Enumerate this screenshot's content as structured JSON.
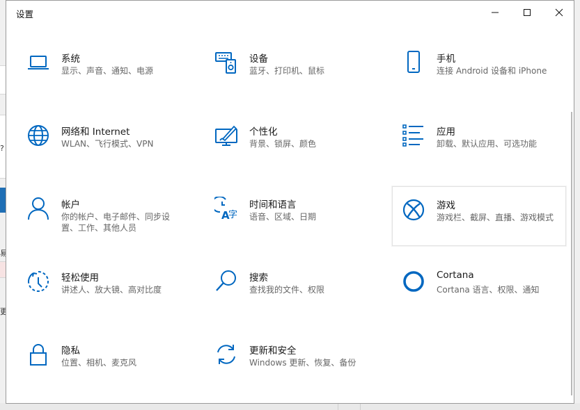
{
  "window": {
    "title": "设置"
  },
  "controls": {
    "minimize": "minimize-icon",
    "maximize": "maximize-icon",
    "close": "close-icon"
  },
  "accent": "#0067c0",
  "background_fragments": {
    "question": "?",
    "char_yi": "易",
    "char_geng": "更"
  },
  "tiles": [
    {
      "key": "system",
      "title": "系统",
      "desc": "显示、声音、通知、电源",
      "icon": "laptop-icon"
    },
    {
      "key": "devices",
      "title": "设备",
      "desc": "蓝牙、打印机、鼠标",
      "icon": "devices-icon"
    },
    {
      "key": "phone",
      "title": "手机",
      "desc": "连接 Android 设备和 iPhone",
      "icon": "phone-icon"
    },
    {
      "key": "network",
      "title": "网络和 Internet",
      "desc": "WLAN、飞行模式、VPN",
      "icon": "globe-icon"
    },
    {
      "key": "personalization",
      "title": "个性化",
      "desc": "背景、锁屏、颜色",
      "icon": "personalization-icon"
    },
    {
      "key": "apps",
      "title": "应用",
      "desc": "卸载、默认应用、可选功能",
      "icon": "apps-list-icon"
    },
    {
      "key": "accounts",
      "title": "帐户",
      "desc": "你的帐户、电子邮件、同步设置、工作、其他人员",
      "icon": "person-icon"
    },
    {
      "key": "time",
      "title": "时间和语言",
      "desc": "语音、区域、日期",
      "icon": "time-language-icon"
    },
    {
      "key": "gaming",
      "title": "游戏",
      "desc": "游戏栏、截屏、直播、游戏模式",
      "icon": "xbox-icon"
    },
    {
      "key": "ease",
      "title": "轻松使用",
      "desc": "讲述人、放大镜、高对比度",
      "icon": "ease-of-access-icon"
    },
    {
      "key": "search",
      "title": "搜索",
      "desc": "查找我的文件、权限",
      "icon": "search-icon"
    },
    {
      "key": "cortana",
      "title": "Cortana",
      "desc": "Cortana 语言、权限、通知",
      "icon": "cortana-icon"
    },
    {
      "key": "privacy",
      "title": "隐私",
      "desc": "位置、相机、麦克风",
      "icon": "lock-icon"
    },
    {
      "key": "update",
      "title": "更新和安全",
      "desc": "Windows 更新、恢复、备份",
      "icon": "update-sync-icon"
    }
  ]
}
